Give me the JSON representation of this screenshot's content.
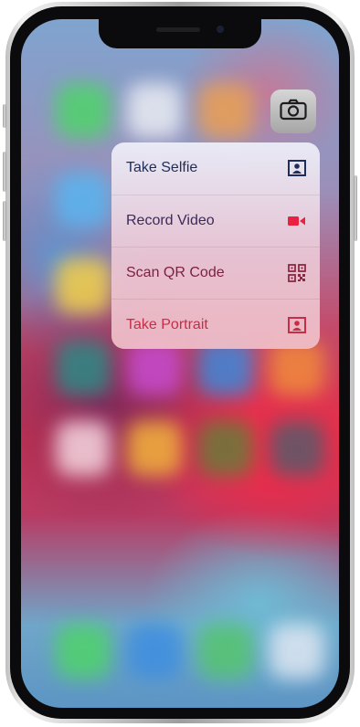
{
  "menu": {
    "items": [
      {
        "label": "Take Selfie",
        "icon": "selfie-portrait-icon",
        "color": "#1f2d5a"
      },
      {
        "label": "Record Video",
        "icon": "video-camera-icon",
        "color": "#3a2a5a"
      },
      {
        "label": "Scan QR Code",
        "icon": "qr-code-icon",
        "color": "#7a2240"
      },
      {
        "label": "Take Portrait",
        "icon": "portrait-icon",
        "color": "#c62e48"
      }
    ]
  },
  "app_icon": {
    "name": "camera-icon",
    "color": "#b3b3b3"
  }
}
